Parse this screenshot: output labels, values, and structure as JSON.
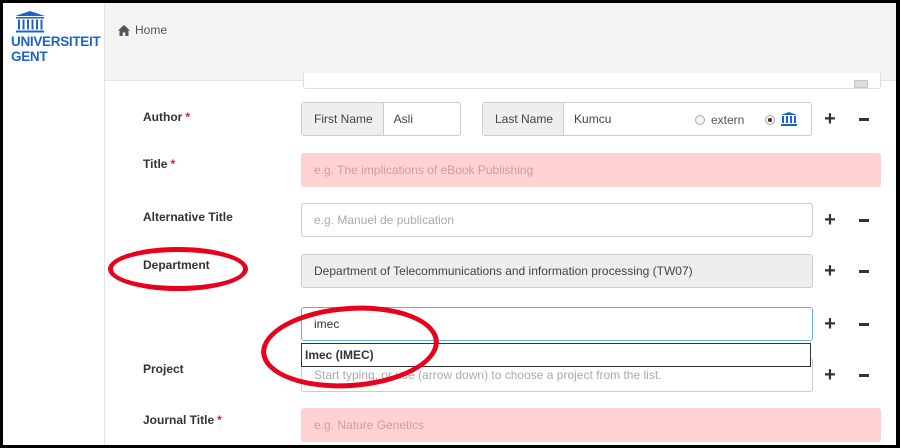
{
  "logo": {
    "line1": "UNIVERSITEIT",
    "line2": "GENT"
  },
  "breadcrumb": {
    "home": "Home"
  },
  "form": {
    "author": {
      "label": "Author",
      "required": "*",
      "first_name_label": "First Name",
      "first_name_value": "Asli",
      "last_name_label": "Last Name",
      "last_name_value": "Kumcu",
      "extern_label": "extern"
    },
    "title": {
      "label": "Title",
      "required": "*",
      "placeholder": "e.g. The implications of eBook Publishing"
    },
    "alt_title": {
      "label": "Alternative Title",
      "placeholder": "e.g. Manuel de publication"
    },
    "department": {
      "label": "Department",
      "value": "Department of Telecommunications and information processing (TW07)",
      "search_value": "imec",
      "suggestion": "Imec (IMEC)"
    },
    "project": {
      "label": "Project",
      "placeholder": "Start typing, or use (arrow down) to choose a project from the list."
    },
    "journal_title": {
      "label": "Journal Title",
      "required": "*",
      "placeholder": "e.g. Nature Genetics"
    }
  },
  "buttons": {
    "plus": "+"
  },
  "colors": {
    "brand": "#1e64c8",
    "error_bg": "#ffd2d2",
    "required": "#e0182d",
    "annotation": "#e8001c"
  }
}
